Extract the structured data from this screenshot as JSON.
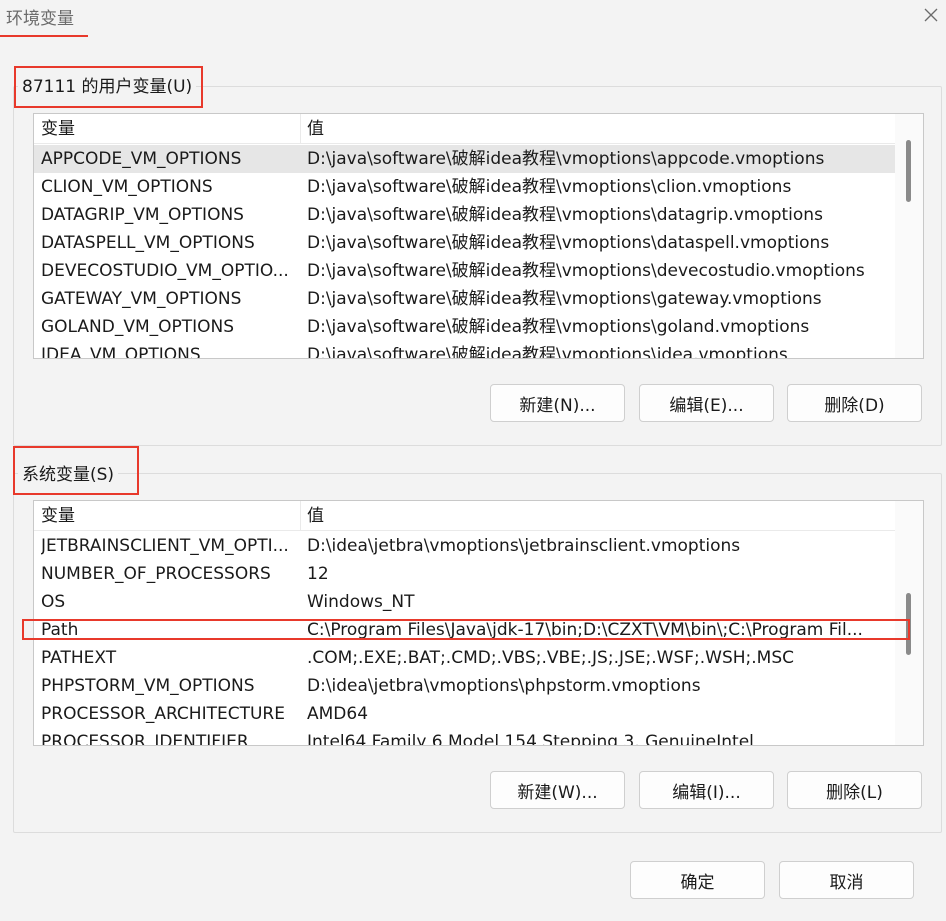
{
  "window": {
    "title": "环境变量",
    "close_icon": "close-icon"
  },
  "user_vars": {
    "legend": "87111 的用户变量(U)",
    "columns": [
      "变量",
      "值"
    ],
    "rows": [
      {
        "name": "APPCODE_VM_OPTIONS",
        "value": "D:\\java\\software\\破解idea教程\\vmoptions\\appcode.vmoptions"
      },
      {
        "name": "CLION_VM_OPTIONS",
        "value": "D:\\java\\software\\破解idea教程\\vmoptions\\clion.vmoptions"
      },
      {
        "name": "DATAGRIP_VM_OPTIONS",
        "value": "D:\\java\\software\\破解idea教程\\vmoptions\\datagrip.vmoptions"
      },
      {
        "name": "DATASPELL_VM_OPTIONS",
        "value": "D:\\java\\software\\破解idea教程\\vmoptions\\dataspell.vmoptions"
      },
      {
        "name": "DEVECOSTUDIO_VM_OPTIO...",
        "value": "D:\\java\\software\\破解idea教程\\vmoptions\\devecostudio.vmoptions"
      },
      {
        "name": "GATEWAY_VM_OPTIONS",
        "value": "D:\\java\\software\\破解idea教程\\vmoptions\\gateway.vmoptions"
      },
      {
        "name": "GOLAND_VM_OPTIONS",
        "value": "D:\\java\\software\\破解idea教程\\vmoptions\\goland.vmoptions"
      },
      {
        "name": "IDEA_VM_OPTIONS",
        "value": "D:\\java\\software\\破解idea教程\\vmoptions\\idea.vmoptions"
      }
    ],
    "buttons": {
      "new": "新建(N)...",
      "edit": "编辑(E)...",
      "delete": "删除(D)"
    }
  },
  "system_vars": {
    "legend": "系统变量(S)",
    "columns": [
      "变量",
      "值"
    ],
    "rows": [
      {
        "name": "JETBRAINSCLIENT_VM_OPTI...",
        "value": "D:\\idea\\jetbra\\vmoptions\\jetbrainsclient.vmoptions"
      },
      {
        "name": "NUMBER_OF_PROCESSORS",
        "value": "12"
      },
      {
        "name": "OS",
        "value": "Windows_NT"
      },
      {
        "name": "Path",
        "value": "C:\\Program Files\\Java\\jdk-17\\bin;D:\\CZXT\\VM\\bin\\;C:\\Program Fil..."
      },
      {
        "name": "PATHEXT",
        "value": ".COM;.EXE;.BAT;.CMD;.VBS;.VBE;.JS;.JSE;.WSF;.WSH;.MSC"
      },
      {
        "name": "PHPSTORM_VM_OPTIONS",
        "value": "D:\\idea\\jetbra\\vmoptions\\phpstorm.vmoptions"
      },
      {
        "name": "PROCESSOR_ARCHITECTURE",
        "value": "AMD64"
      },
      {
        "name": "PROCESSOR_IDENTIFIER",
        "value": "Intel64 Family 6 Model 154 Stepping 3, GenuineIntel"
      }
    ],
    "buttons": {
      "new": "新建(W)...",
      "edit": "编辑(I)...",
      "delete": "删除(L)"
    }
  },
  "footer": {
    "ok": "确定",
    "cancel": "取消"
  },
  "accent_colors": {
    "highlight": "#e8392b",
    "selected_row": "#e6e6e6"
  }
}
